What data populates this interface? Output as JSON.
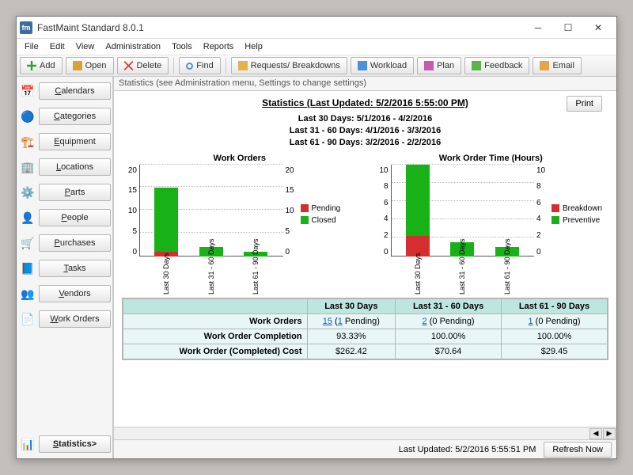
{
  "window": {
    "title": "FastMaint Standard 8.0.1",
    "app_icon_label": "fm"
  },
  "menu": [
    "File",
    "Edit",
    "View",
    "Administration",
    "Tools",
    "Reports",
    "Help"
  ],
  "toolbar": {
    "add": "Add",
    "open": "Open",
    "delete": "Delete",
    "find": "Find",
    "requests": "Requests/ Breakdowns",
    "workload": "Workload",
    "plan": "Plan",
    "feedback": "Feedback",
    "email": "Email"
  },
  "sidebar": {
    "items": [
      {
        "icon": "📅",
        "label": "Calendars",
        "u": "C"
      },
      {
        "icon": "🔵",
        "label": "Categories",
        "u": "C"
      },
      {
        "icon": "🏗️",
        "label": "Equipment",
        "u": "E"
      },
      {
        "icon": "🏢",
        "label": "Locations",
        "u": "L"
      },
      {
        "icon": "⚙️",
        "label": "Parts",
        "u": "P"
      },
      {
        "icon": "👤",
        "label": "People",
        "u": "P"
      },
      {
        "icon": "🛒",
        "label": "Purchases",
        "u": "P"
      },
      {
        "icon": "📘",
        "label": "Tasks",
        "u": "T"
      },
      {
        "icon": "👥",
        "label": "Vendors",
        "u": "V"
      },
      {
        "icon": "📄",
        "label": "Work Orders",
        "u": "W"
      },
      {
        "icon": "📊",
        "label": "Statistics>",
        "u": "S",
        "active": true
      }
    ]
  },
  "hint": "Statistics (see Administration menu, Settings to change settings)",
  "stats": {
    "title": "Statistics (Last Updated: 5/2/2016 5:55:00 PM)",
    "ranges": [
      "Last 30 Days: 5/1/2016 - 4/2/2016",
      "Last 31 - 60 Days: 4/1/2016 - 3/3/2016",
      "Last 61 - 90 Days: 3/2/2016 - 2/2/2016"
    ],
    "print": "Print"
  },
  "chart_data": [
    {
      "type": "bar-stacked",
      "title": "Work Orders",
      "ylim": [
        0,
        20
      ],
      "yticks": [
        0,
        5,
        10,
        15,
        20
      ],
      "categories": [
        "Last 30 Days",
        "Last 31 - 60 Days",
        "Last 61 - 90 Days"
      ],
      "series": [
        {
          "name": "Pending",
          "color": "#d42e2e",
          "values": [
            1,
            0,
            0
          ]
        },
        {
          "name": "Closed",
          "color": "#18b218",
          "values": [
            14,
            2,
            1
          ]
        }
      ]
    },
    {
      "type": "bar-stacked",
      "title": "Work Order Time (Hours)",
      "ylim": [
        0,
        10
      ],
      "yticks": [
        0,
        2,
        4,
        6,
        8,
        10
      ],
      "categories": [
        "Last 30 Days",
        "Last 31 - 60 Days",
        "Last 61 - 90 Days"
      ],
      "series": [
        {
          "name": "Breakdown",
          "color": "#d42e2e",
          "values": [
            2.2,
            0,
            0
          ]
        },
        {
          "name": "Preventive",
          "color": "#18b218",
          "values": [
            7.8,
            1.5,
            1
          ]
        }
      ]
    }
  ],
  "table": {
    "columns": [
      "",
      "Last 30 Days",
      "Last 31 - 60 Days",
      "Last 61 - 90 Days"
    ],
    "rows": [
      {
        "label": "Work Orders",
        "cells": [
          {
            "link": "15",
            "extra": " (",
            "link2": "1",
            "extra2": " Pending)"
          },
          {
            "link": "2",
            "extra": " (0 Pending)"
          },
          {
            "link": "1",
            "extra": " (0 Pending)"
          }
        ]
      },
      {
        "label": "Work Order Completion",
        "cells": [
          {
            "text": "93.33%"
          },
          {
            "text": "100.00%"
          },
          {
            "text": "100.00%"
          }
        ]
      },
      {
        "label": "Work Order (Completed) Cost",
        "cells": [
          {
            "text": "$262.42"
          },
          {
            "text": "$70.64"
          },
          {
            "text": "$29.45"
          }
        ]
      }
    ]
  },
  "status": {
    "updated": "Last Updated: 5/2/2016 5:55:51 PM",
    "refresh": "Refresh Now"
  }
}
